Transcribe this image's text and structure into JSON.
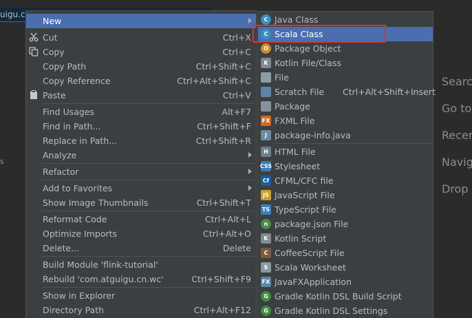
{
  "background": {
    "tab_text": "uigu.cn",
    "left_tick": "s",
    "hints": [
      "Search",
      "Go to",
      "Recen",
      "Navig",
      "Drop"
    ]
  },
  "menu": {
    "items": [
      {
        "label": "New",
        "shortcut": "",
        "submenu": true,
        "icon": "",
        "selected": true
      },
      {
        "label": "Cut",
        "shortcut": "Ctrl+X",
        "icon": "scissors-icon"
      },
      {
        "label": "Copy",
        "shortcut": "Ctrl+C",
        "icon": "copy-icon"
      },
      {
        "label": "Copy Path",
        "shortcut": "Ctrl+Shift+C",
        "icon": ""
      },
      {
        "label": "Copy Reference",
        "shortcut": "Ctrl+Alt+Shift+C",
        "icon": ""
      },
      {
        "label": "Paste",
        "shortcut": "Ctrl+V",
        "icon": "clipboard-icon"
      },
      {
        "label": "Find Usages",
        "shortcut": "Alt+F7",
        "icon": ""
      },
      {
        "label": "Find in Path...",
        "shortcut": "Ctrl+Shift+F",
        "icon": ""
      },
      {
        "label": "Replace in Path...",
        "shortcut": "Ctrl+Shift+R",
        "icon": ""
      },
      {
        "label": "Analyze",
        "shortcut": "",
        "submenu": true,
        "icon": ""
      },
      {
        "label": "Refactor",
        "shortcut": "",
        "submenu": true,
        "icon": ""
      },
      {
        "label": "Add to Favorites",
        "shortcut": "",
        "submenu": true,
        "icon": ""
      },
      {
        "label": "Show Image Thumbnails",
        "shortcut": "Ctrl+Shift+T",
        "icon": ""
      },
      {
        "label": "Reformat Code",
        "shortcut": "Ctrl+Alt+L",
        "icon": ""
      },
      {
        "label": "Optimize Imports",
        "shortcut": "Ctrl+Alt+O",
        "icon": ""
      },
      {
        "label": "Delete...",
        "shortcut": "Delete",
        "icon": ""
      },
      {
        "label": "Build Module 'flink-tutorial'",
        "shortcut": "",
        "icon": ""
      },
      {
        "label": "Rebuild 'com.atguigu.cn.wc'",
        "shortcut": "Ctrl+Shift+F9",
        "icon": ""
      },
      {
        "label": "Show in Explorer",
        "shortcut": "",
        "icon": ""
      },
      {
        "label": "Directory Path",
        "shortcut": "Ctrl+Alt+F12",
        "icon": ""
      }
    ]
  },
  "submenu": {
    "items": [
      {
        "label": "Java Class",
        "icon": "java-class-icon",
        "icon_text": "C",
        "color": "#3592c4"
      },
      {
        "label": "Scala Class",
        "icon": "scala-class-icon",
        "icon_text": "C",
        "color": "#3592c4",
        "selected": true
      },
      {
        "label": "Package Object",
        "icon": "package-object-icon",
        "icon_text": "O",
        "color": "#c98f2a"
      },
      {
        "label": "Kotlin File/Class",
        "icon": "kotlin-file-icon",
        "icon_text": "K",
        "color": "#7f8b91"
      },
      {
        "label": "File",
        "icon": "file-icon",
        "icon_text": "",
        "color": "#8c9da3"
      },
      {
        "label": "Scratch File",
        "shortcut": "Ctrl+Alt+Shift+Insert",
        "icon": "scratch-file-icon",
        "icon_text": "",
        "color": "#5b84a8"
      },
      {
        "label": "Package",
        "icon": "package-icon",
        "icon_text": "",
        "color": "#87939a"
      },
      {
        "label": "FXML File",
        "icon": "fxml-file-icon",
        "icon_text": "FX",
        "color": "#d2691e"
      },
      {
        "label": "package-info.java",
        "icon": "package-info-icon",
        "icon_text": "J",
        "color": "#6c8ba3"
      },
      {
        "label": "HTML File",
        "icon": "html-file-icon",
        "icon_text": "H",
        "color": "#6d7f87"
      },
      {
        "label": "Stylesheet",
        "icon": "stylesheet-icon",
        "icon_text": "CSS",
        "color": "#3d7ab3"
      },
      {
        "label": "CFML/CFC file",
        "icon": "cfml-file-icon",
        "icon_text": "Cf",
        "color": "#1f5c99"
      },
      {
        "label": "JavaScript File",
        "icon": "javascript-file-icon",
        "icon_text": "JS",
        "color": "#c9a227"
      },
      {
        "label": "TypeScript File",
        "icon": "typescript-file-icon",
        "icon_text": "TS",
        "color": "#3a7fb8"
      },
      {
        "label": "package.json File",
        "icon": "package-json-icon",
        "icon_text": "n",
        "color": "#4c8b4c"
      },
      {
        "label": "Kotlin Script",
        "icon": "kotlin-script-icon",
        "icon_text": "K",
        "color": "#7f8b91"
      },
      {
        "label": "CoffeeScript File",
        "icon": "coffeescript-file-icon",
        "icon_text": "C",
        "color": "#7a5c3e"
      },
      {
        "label": "Scala Worksheet",
        "icon": "scala-worksheet-icon",
        "icon_text": "S",
        "color": "#8a9aa2"
      },
      {
        "label": "JavaFXApplication",
        "icon": "javafx-application-icon",
        "icon_text": "FX",
        "color": "#5b84a8"
      },
      {
        "label": "Gradle Kotlin DSL Build Script",
        "icon": "gradle-icon",
        "icon_text": "G",
        "color": "#3e8e41"
      },
      {
        "label": "Gradle Kotlin DSL Settings",
        "icon": "gradle-settings-icon",
        "icon_text": "G",
        "color": "#3e8e41"
      }
    ]
  }
}
